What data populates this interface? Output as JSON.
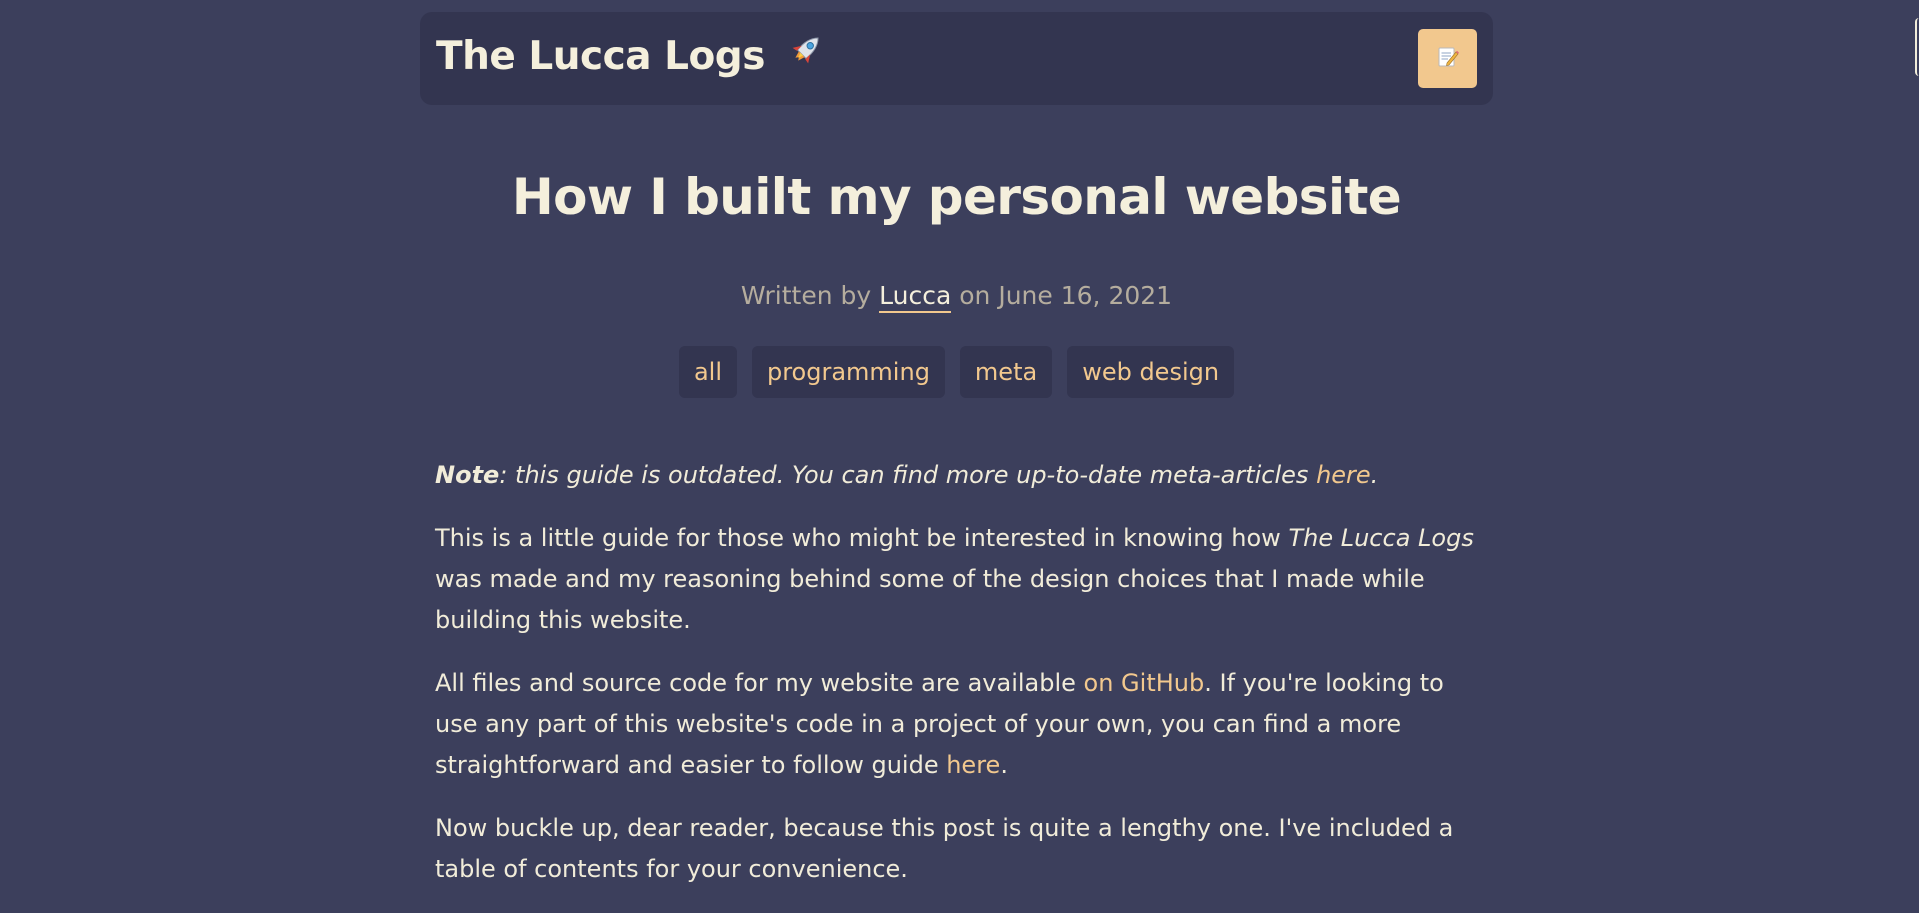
{
  "header": {
    "site_title": "The Lucca Logs",
    "rocket_glyph": "🚀",
    "edit_button_icon": "memo-icon",
    "accent": "#f2c88e"
  },
  "post": {
    "title": "How I built my personal website",
    "byline_prefix": "Written by",
    "author": "Lucca",
    "byline_middle": "on",
    "date": "June 16, 2021",
    "tags": [
      "all",
      "programming",
      "meta",
      "web design"
    ]
  },
  "content": {
    "note": {
      "label": "Note",
      "text": ": this guide is outdated. You can find more up-to-date meta-articles ",
      "link": "here",
      "end": "."
    },
    "p1": {
      "a": "This is a little guide for those who might be interested in knowing how ",
      "em": "The Lucca Logs",
      "b": " was made and my reasoning behind some of the design choices that I made while building this website."
    },
    "p2": {
      "a": "All files and source code for my website are available ",
      "link1": "on GitHub",
      "b": ". If you're looking to use any part of this website's code in a project of your own, you can find a more straightforward and easier to follow guide ",
      "link2": "here",
      "c": "."
    },
    "p3": "Now buckle up, dear reader, because this post is quite a lengthy one. I've included a table of contents for your convenience."
  },
  "colors": {
    "background": "#3c3f5c",
    "surface": "#333550",
    "text": "#f1ecd9",
    "muted": "#b5ad9e",
    "accent": "#f2c88e"
  }
}
